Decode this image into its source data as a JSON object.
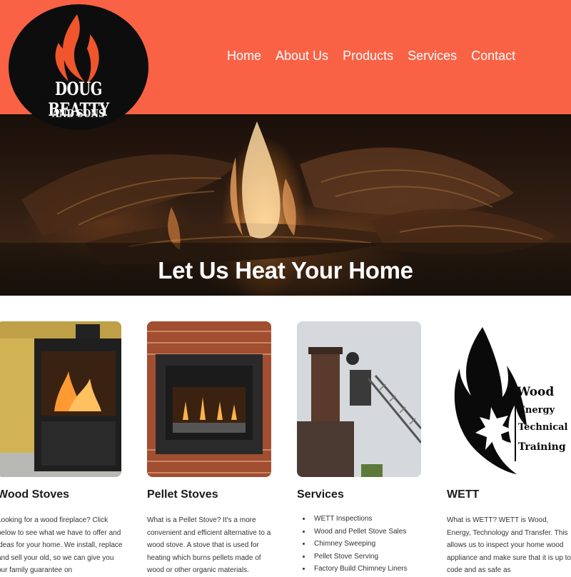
{
  "brand": {
    "name": "DOUG BEATTY",
    "sub": "AND SONS"
  },
  "nav": [
    {
      "label": "Home"
    },
    {
      "label": "About Us"
    },
    {
      "label": "Products"
    },
    {
      "label": "Services"
    },
    {
      "label": "Contact"
    }
  ],
  "hero": {
    "title": "Let Us Heat Your Home"
  },
  "cards": [
    {
      "title": "Wood Stoves",
      "text": "Looking for a wood fireplace? Click below to see what we have to offer and ideas for your home. We install, replace and sell your old, so we can give you our family guarantee on"
    },
    {
      "title": "Pellet Stoves",
      "text": "What is a Pellet Stove? It's a more convenient and efficient alternative to a wood stove. A stove that is used for heating which burns pellets made of wood or other organic materials."
    },
    {
      "title": "Services",
      "items": [
        "WETT Inspections",
        "Wood and Pellet Stove Sales",
        "Chimney Sweeping",
        "Pellet Stove Serving",
        "Factory Build Chimney Liners"
      ]
    },
    {
      "title": "WETT",
      "text": "What is WETT? WETT is Wood, Energy, Technology and Transfer. This allows us to inspect your home wood appliance and make sure that it is up to code and as safe as"
    }
  ],
  "wett_logo": {
    "lines": [
      "Wood",
      "Energy",
      "Technical",
      "Training"
    ]
  },
  "colors": {
    "header_bg": "#fa6246",
    "logo_bg": "#0d0d0d",
    "flame": "#f0552c",
    "text": "#1a1a1a"
  },
  "icons": [
    "flame-logo-icon",
    "wett-flame-icon",
    "maple-leaf-icon"
  ]
}
